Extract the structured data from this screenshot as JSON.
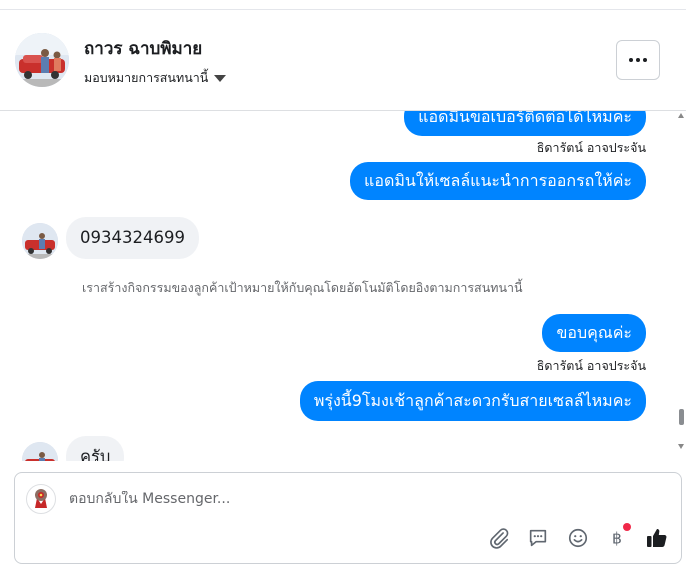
{
  "header": {
    "contact_name": "ถาวร ฉาบพิมาย",
    "assign_label": "มอบหมายการสนทนานี้"
  },
  "messages": [
    {
      "type": "outgoing",
      "text": "แอดมินขอเบอร์ติดต่อได้ไหมคะ"
    },
    {
      "type": "sender",
      "text": "ธิดารัตน์ อาจประจัน"
    },
    {
      "type": "outgoing",
      "text": "แอดมินให้เซลล์แนะนำการออกรถให้ค่ะ"
    },
    {
      "type": "incoming",
      "text": "0934324699"
    },
    {
      "type": "system",
      "text": "เราสร้างกิจกรรมของลูกค้าเป้าหมายให้กับคุณโดยอัตโนมัติโดยอิงตามการสนทนานี้"
    },
    {
      "type": "outgoing",
      "text": "ขอบคุณค่ะ"
    },
    {
      "type": "sender",
      "text": "ธิดารัตน์ อาจประจัน"
    },
    {
      "type": "outgoing",
      "text": "พรุ่งนี้9โมงเช้าลูกค้าสะดวกรับสายเซลล์ไหมคะ"
    },
    {
      "type": "incoming",
      "text": "ครับ"
    }
  ],
  "composer": {
    "placeholder": "ตอบกลับใน Messenger...",
    "tools": [
      "paperclip-icon",
      "saved-reply-icon",
      "emoji-icon",
      "baht-payment-icon",
      "thumbs-up-icon"
    ]
  },
  "colors": {
    "outgoing_bubble": "#0084ff",
    "incoming_bubble": "#f0f2f5",
    "notification_dot": "#f02849"
  }
}
